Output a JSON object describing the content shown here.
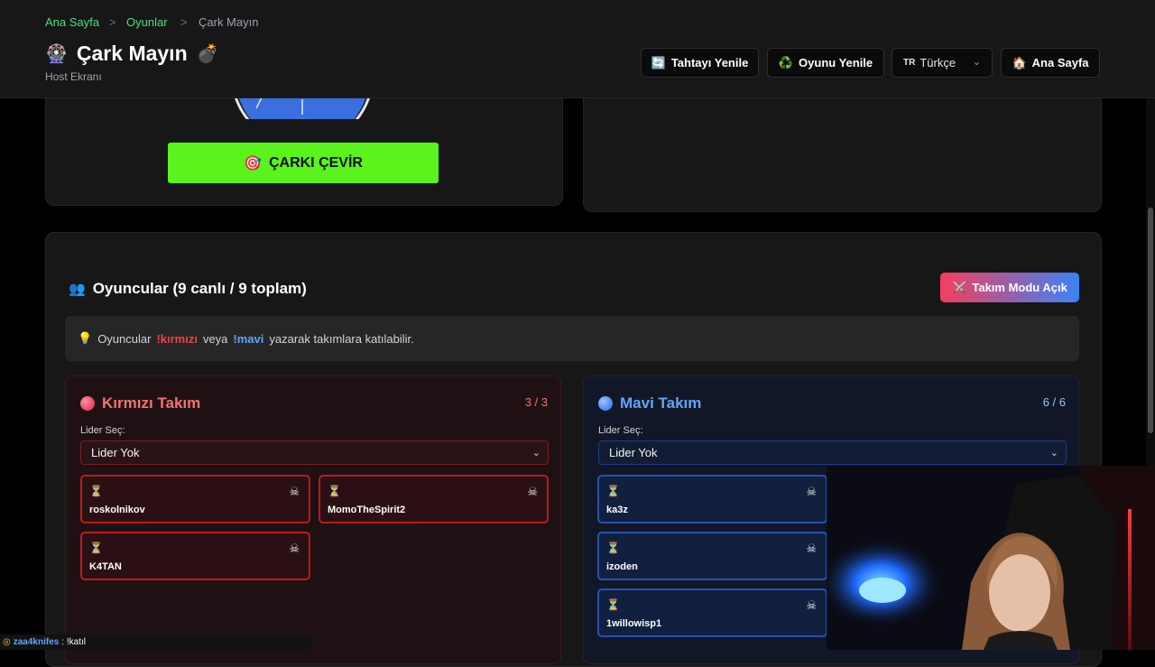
{
  "breadcrumb": {
    "home": "Ana Sayfa",
    "games": "Oyunlar",
    "current": "Çark Mayın",
    "sep": ">"
  },
  "header": {
    "title": "Çark Mayın",
    "subtitle": "Host Ekranı",
    "btn_refresh_board": "Tahtayı Yenile",
    "btn_restart_game": "Oyunu Yenile",
    "lang_code": "TR",
    "lang_label": "Türkçe",
    "btn_home": "Ana Sayfa"
  },
  "wheel": {
    "spin_label": "ÇARKI ÇEVİR"
  },
  "players": {
    "title": "Oyuncular (9 canlı / 9 toplam)",
    "team_mode": "Takım Modu Açık",
    "tip_prefix": "Oyuncular",
    "tip_red": "!kırmızı",
    "tip_mid": "veya",
    "tip_blue": "!mavi",
    "tip_suffix": "yazarak takımlara katılabilir."
  },
  "red_team": {
    "name": "Kırmızı Takım",
    "count": "3 / 3",
    "leader_label": "Lider Seç:",
    "leader_value": "Lider Yok",
    "members": [
      "roskolnikov",
      "MomoTheSpirit2",
      "K4TAN"
    ]
  },
  "blue_team": {
    "name": "Mavi Takım",
    "count": "6 / 6",
    "leader_label": "Lider Seç:",
    "leader_value": "Lider Yok",
    "members": [
      "ka3z",
      "izoden",
      "1willowisp1"
    ]
  },
  "chat": {
    "user": "zaa4knifes",
    "message": ": !katıl"
  },
  "colors": {
    "accent_green": "#5af41c",
    "red": "#ef4444",
    "blue": "#3b82f6"
  }
}
